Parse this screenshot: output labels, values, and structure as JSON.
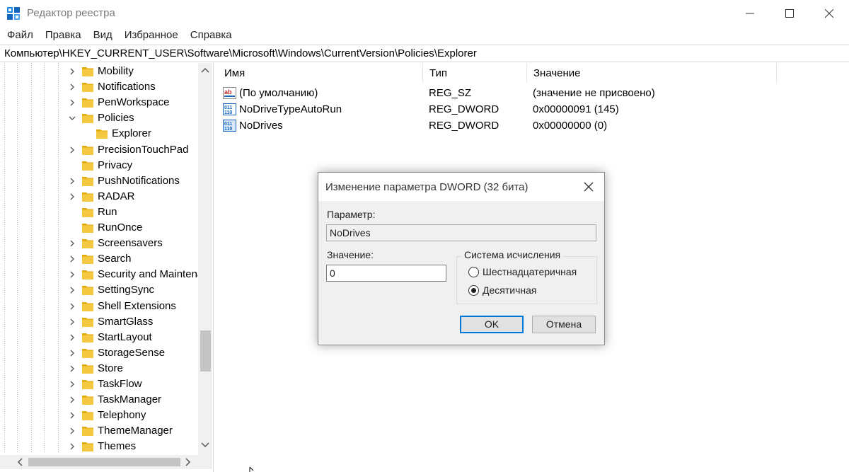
{
  "window": {
    "title": "Редактор реестра"
  },
  "menu": [
    "Файл",
    "Правка",
    "Вид",
    "Избранное",
    "Справка"
  ],
  "address": "Компьютер\\HKEY_CURRENT_USER\\Software\\Microsoft\\Windows\\CurrentVersion\\Policies\\Explorer",
  "tree": {
    "items": [
      {
        "label": "Mobility",
        "state": "collapsed"
      },
      {
        "label": "Notifications",
        "state": "collapsed"
      },
      {
        "label": "PenWorkspace",
        "state": "collapsed"
      },
      {
        "label": "Policies",
        "state": "expanded"
      },
      {
        "label": "Explorer",
        "state": "child-selected"
      },
      {
        "label": "PrecisionTouchPad",
        "state": "collapsed"
      },
      {
        "label": "Privacy",
        "state": "none"
      },
      {
        "label": "PushNotifications",
        "state": "collapsed"
      },
      {
        "label": "RADAR",
        "state": "collapsed"
      },
      {
        "label": "Run",
        "state": "none"
      },
      {
        "label": "RunOnce",
        "state": "none"
      },
      {
        "label": "Screensavers",
        "state": "collapsed"
      },
      {
        "label": "Search",
        "state": "collapsed"
      },
      {
        "label": "Security and Maintena",
        "state": "collapsed"
      },
      {
        "label": "SettingSync",
        "state": "collapsed"
      },
      {
        "label": "Shell Extensions",
        "state": "collapsed"
      },
      {
        "label": "SmartGlass",
        "state": "collapsed"
      },
      {
        "label": "StartLayout",
        "state": "collapsed"
      },
      {
        "label": "StorageSense",
        "state": "collapsed"
      },
      {
        "label": "Store",
        "state": "collapsed"
      },
      {
        "label": "TaskFlow",
        "state": "collapsed"
      },
      {
        "label": "TaskManager",
        "state": "collapsed"
      },
      {
        "label": "Telephony",
        "state": "collapsed"
      },
      {
        "label": "ThemeManager",
        "state": "collapsed"
      },
      {
        "label": "Themes",
        "state": "collapsed"
      }
    ]
  },
  "list": {
    "columns": {
      "name": "Имя",
      "type": "Тип",
      "value": "Значение"
    },
    "rows": [
      {
        "icon": "string-value-icon",
        "name": "(По умолчанию)",
        "type": "REG_SZ",
        "value": "(значение не присвоено)"
      },
      {
        "icon": "binary-value-icon",
        "name": "NoDriveTypeAutoRun",
        "type": "REG_DWORD",
        "value": "0x00000091 (145)"
      },
      {
        "icon": "binary-value-icon",
        "name": "NoDrives",
        "type": "REG_DWORD",
        "value": "0x00000000 (0)"
      }
    ]
  },
  "dialog": {
    "title": "Изменение параметра DWORD (32 бита)",
    "param_label": "Параметр:",
    "param_value": "NoDrives",
    "value_label": "Значение:",
    "value": "0",
    "base_legend": "Система исчисления",
    "radio_hex": "Шестнадцатеричная",
    "radio_dec": "Десятичная",
    "selected_base": "dec",
    "ok_label": "OK",
    "cancel_label": "Отмена"
  },
  "colors": {
    "folder": "#f5c842",
    "folder_dark": "#e0a800",
    "accent": "#0078d7"
  }
}
